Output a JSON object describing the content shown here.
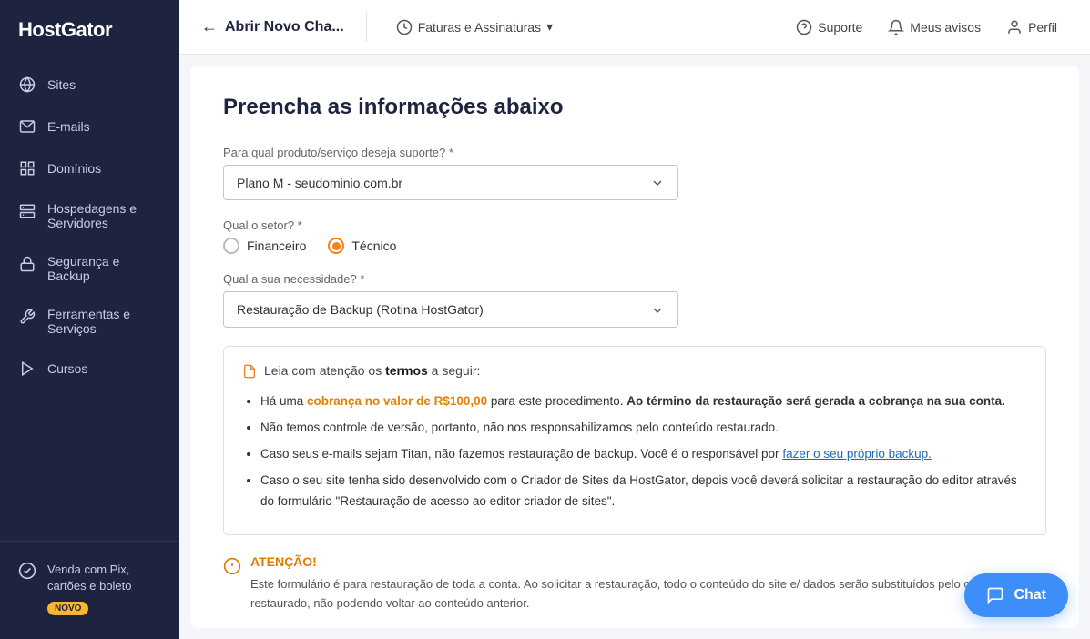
{
  "sidebar": {
    "logo": "HostGator",
    "items": [
      {
        "id": "sites",
        "label": "Sites",
        "icon": "globe"
      },
      {
        "id": "emails",
        "label": "E-mails",
        "icon": "email"
      },
      {
        "id": "dominios",
        "label": "Domínios",
        "icon": "grid"
      },
      {
        "id": "hospedagens",
        "label": "Hospedagens e Servidores",
        "icon": "server"
      },
      {
        "id": "seguranca",
        "label": "Segurança e Backup",
        "icon": "lock"
      },
      {
        "id": "ferramentas",
        "label": "Ferramentas e Serviços",
        "icon": "wrench"
      },
      {
        "id": "cursos",
        "label": "Cursos",
        "icon": "play"
      }
    ],
    "bottom": {
      "label": "Venda com Pix, cartões e boleto",
      "badge": "NOVO"
    }
  },
  "topnav": {
    "back_label": "Abrir Novo Cha...",
    "billing_label": "Faturas e Assinaturas",
    "support_label": "Suporte",
    "notices_label": "Meus avisos",
    "profile_label": "Perfil"
  },
  "page": {
    "title": "Preencha as informações abaixo",
    "product_label": "Para qual produto/serviço deseja suporte? *",
    "product_value": "Plano M - seudominio.com.br",
    "sector_label": "Qual o setor? *",
    "sector_options": [
      {
        "id": "financeiro",
        "label": "Financeiro",
        "selected": false
      },
      {
        "id": "tecnico",
        "label": "Técnico",
        "selected": true
      }
    ],
    "need_label": "Qual a sua necessidade? *",
    "need_value": "Restauração de Backup (Rotina HostGator)",
    "terms_header_prefix": "Leia com atenção os ",
    "terms_header_keyword": "termos",
    "terms_header_suffix": " a seguir:",
    "terms": [
      {
        "id": 1,
        "text_prefix": "Há uma ",
        "text_highlight": "cobrança no valor de R$100,00",
        "text_middle": " para este procedimento. ",
        "text_bold": "Ao término da restauração será gerada a cobrança na sua conta.",
        "text_suffix": ""
      },
      {
        "id": 2,
        "text": "Não temos controle de versão, portanto, não nos responsabilizamos pelo conteúdo restaurado."
      },
      {
        "id": 3,
        "text_prefix": "Caso seus e-mails sejam Titan, não fazemos restauração de backup. Você é o responsável por ",
        "link_text": "fazer o seu próprio backup.",
        "text_suffix": ""
      },
      {
        "id": 4,
        "text": "Caso o seu site tenha sido desenvolvido com o Criador de Sites da HostGator, depois você deverá solicitar a restauração do editor através do formulário \"Restauração de acesso ao editor criador de sites\"."
      }
    ],
    "atencao_title": "ATENÇÃO!",
    "atencao_text": "Este formulário é para restauração de toda a conta. Ao solicitar a restauração, todo o conteúdo do site e/ dados serão substituídos pelo conteúdo restaurado, não podendo voltar ao conteúdo anterior."
  },
  "chat": {
    "label": "Chat"
  }
}
